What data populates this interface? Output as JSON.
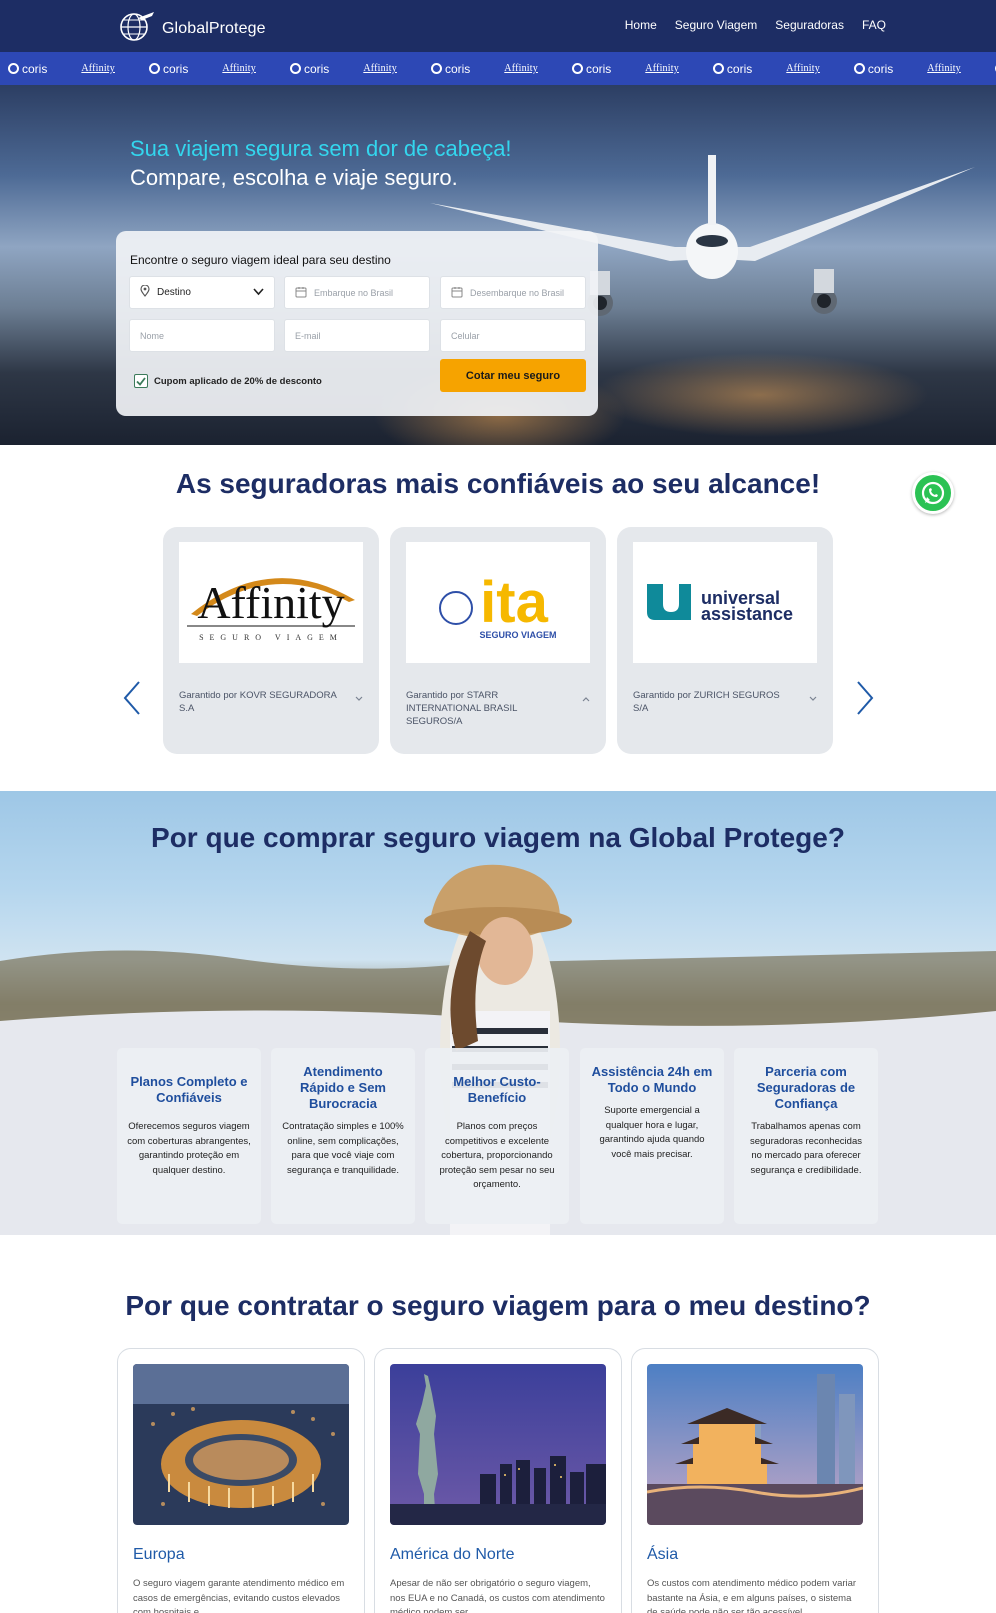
{
  "nav": {
    "brand": "GlobalProtege",
    "links": [
      "Home",
      "Seguro Viagem",
      "Seguradoras",
      "FAQ"
    ]
  },
  "brand_strip": {
    "items": [
      "coris",
      "Affinity",
      "coris",
      "Affinity",
      "coris",
      "Affinity",
      "coris",
      "Affinity",
      "coris",
      "Affinity",
      "coris",
      "Affinity",
      "coris",
      "Affinity",
      "coris",
      "Affinity"
    ]
  },
  "hero": {
    "headline_1": "Sua viajem segura sem dor de cabeça!",
    "headline_2": "Compare, escolha e viaje seguro.",
    "form_title": "Encontre o seguro viagem ideal para seu destino",
    "destino": "Destino",
    "embarque_placeholder": "Embarque no Brasil",
    "desembarque_placeholder": "Desembarque no Brasil",
    "nome_placeholder": "Nome",
    "email_placeholder": "E-mail",
    "celular_placeholder": "Celular",
    "cupom": "Cupom aplicado de 20% de desconto",
    "cta": "Cotar meu seguro"
  },
  "insurers": {
    "title": "As seguradoras mais confiáveis ao seu alcance!",
    "cards": [
      {
        "logo_main": "Affinity",
        "logo_sub": "SEGURO VIAGEM",
        "text": "Garantido por KOVR SEGURADORA S.A",
        "chevron": "down"
      },
      {
        "logo_main": "ita",
        "logo_sub": "SEGURO VIAGEM",
        "text": "Garantido por STARR INTERNATIONAL BRASIL SEGUROS/A",
        "chevron": "up"
      },
      {
        "logo_main": "universal",
        "logo_sub": "assistance",
        "text": "Garantido por ZURICH SEGUROS S/A",
        "chevron": "down"
      }
    ]
  },
  "why_buy": {
    "title": "Por que comprar seguro viagem na Global Protege?",
    "features": [
      {
        "title": "Planos Completo e Confiáveis",
        "desc": "Oferecemos seguros viagem com coberturas abrangentes, garantindo proteção em qualquer destino."
      },
      {
        "title": "Atendimento Rápido e Sem Burocracia",
        "desc": "Contratação simples e 100% online, sem complicações, para que você viaje com segurança e tranquilidade."
      },
      {
        "title": "Melhor Custo-Benefício",
        "desc": "Planos com preços competitivos e excelente cobertura, proporcionando proteção sem pesar no seu orçamento."
      },
      {
        "title": "Assistência 24h em Todo o Mundo",
        "desc": "Suporte emergencial a qualquer hora e lugar, garantindo ajuda quando você mais precisar."
      },
      {
        "title": "Parceria com Seguradoras de Confiança",
        "desc": "Trabalhamos apenas com seguradoras reconhecidas no mercado para oferecer segurança e credibilidade."
      }
    ]
  },
  "destinations": {
    "title": "Por que contratar o seguro viagem para o meu destino?",
    "cards": [
      {
        "name": "Europa",
        "desc": "O seguro viagem garante atendimento médico em casos de emergências, evitando custos elevados com hospitais e"
      },
      {
        "name": "América do Norte",
        "desc": "Apesar de não ser obrigatório o seguro viagem, nos EUA e no Canadá, os custos com atendimento médico podem ser"
      },
      {
        "name": "Ásia",
        "desc": "Os custos com atendimento médico podem variar bastante na Ásia, e em alguns países, o sistema de saúde pode não ser tão acessível."
      }
    ]
  },
  "colors": {
    "nav_bg": "#1d2d64",
    "strip_bg": "#2d48b5",
    "accent_cyan": "#33d6ee",
    "cta_orange": "#f6a300",
    "title_navy": "#1d2d64",
    "feature_blue": "#1f4e9d",
    "whatsapp_green": "#2bc254"
  },
  "icons": [
    "globe-plane-icon",
    "location-pin-icon",
    "calendar-icon",
    "chevron-down-icon",
    "checkbox-checked-icon",
    "whatsapp-icon",
    "chevron-left-icon",
    "chevron-right-icon",
    "chevron-up-icon"
  ]
}
